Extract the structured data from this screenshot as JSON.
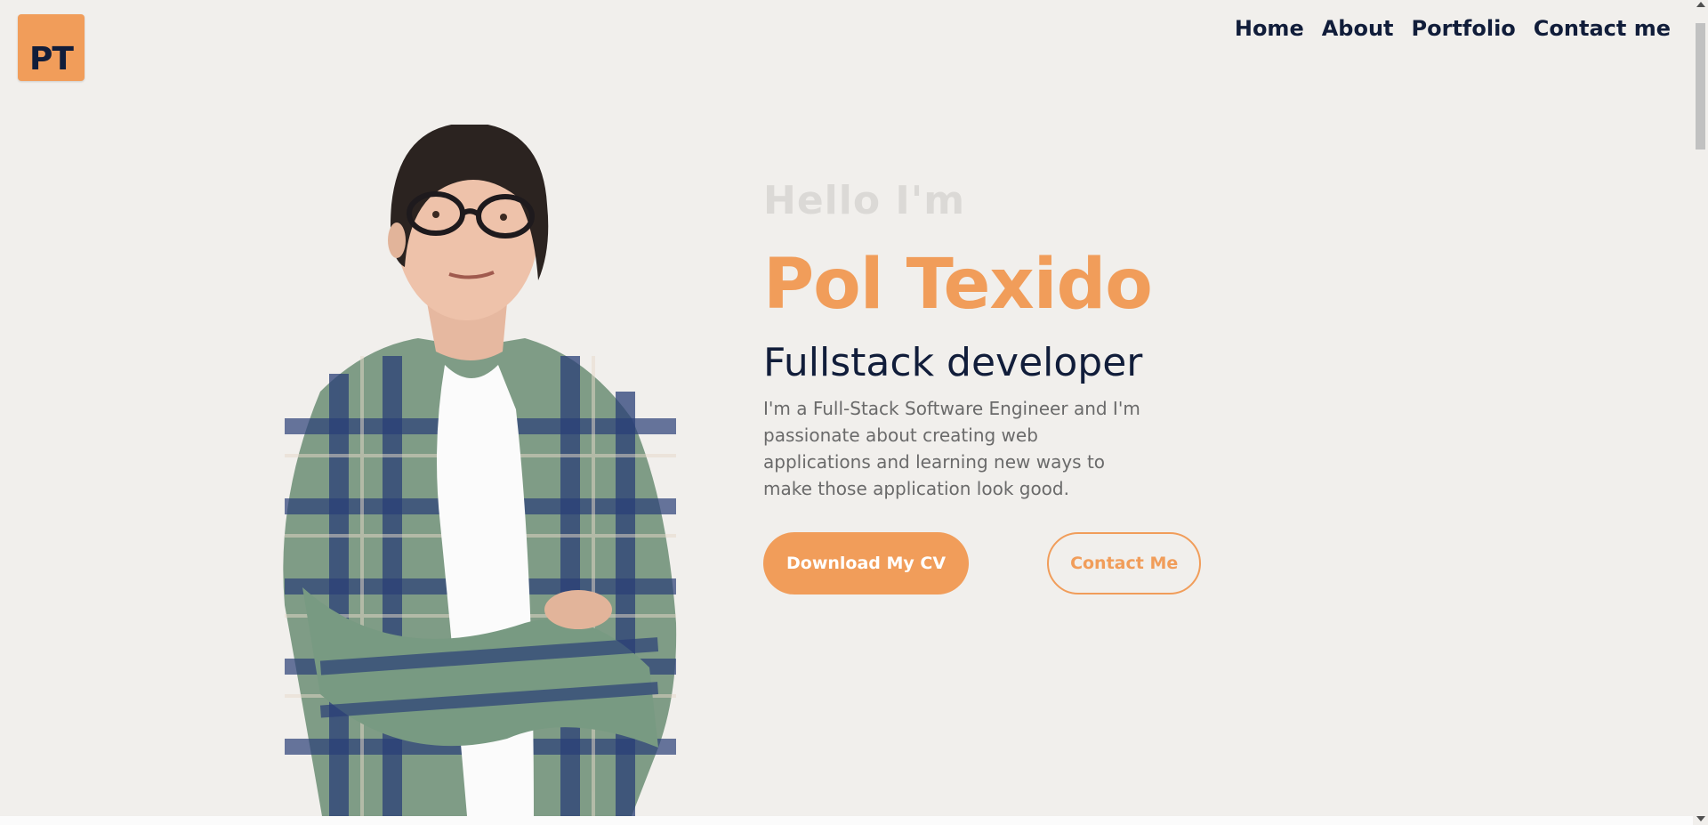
{
  "header": {
    "logo_text": "PT",
    "nav": {
      "home": "Home",
      "about": "About",
      "portfolio": "Portfolio",
      "contact": "Contact me"
    }
  },
  "hero": {
    "greeting": "Hello I'm",
    "name": "Pol Texido",
    "role": "Fullstack developer",
    "bio": "I'm a Full-Stack Software Engineer and I'm passionate about creating web applications and learning new ways to make those application look good.",
    "download_cv_label": "Download My CV",
    "contact_label": "Contact Me"
  },
  "colors": {
    "accent": "#f19d5a",
    "navy": "#111d3a",
    "background": "#f1efec",
    "greeting": "#dbd9d6",
    "body_text": "#6a6a6a"
  },
  "icons": {
    "scroll_up": "arrow-up-icon",
    "scroll_down": "arrow-down-icon"
  }
}
